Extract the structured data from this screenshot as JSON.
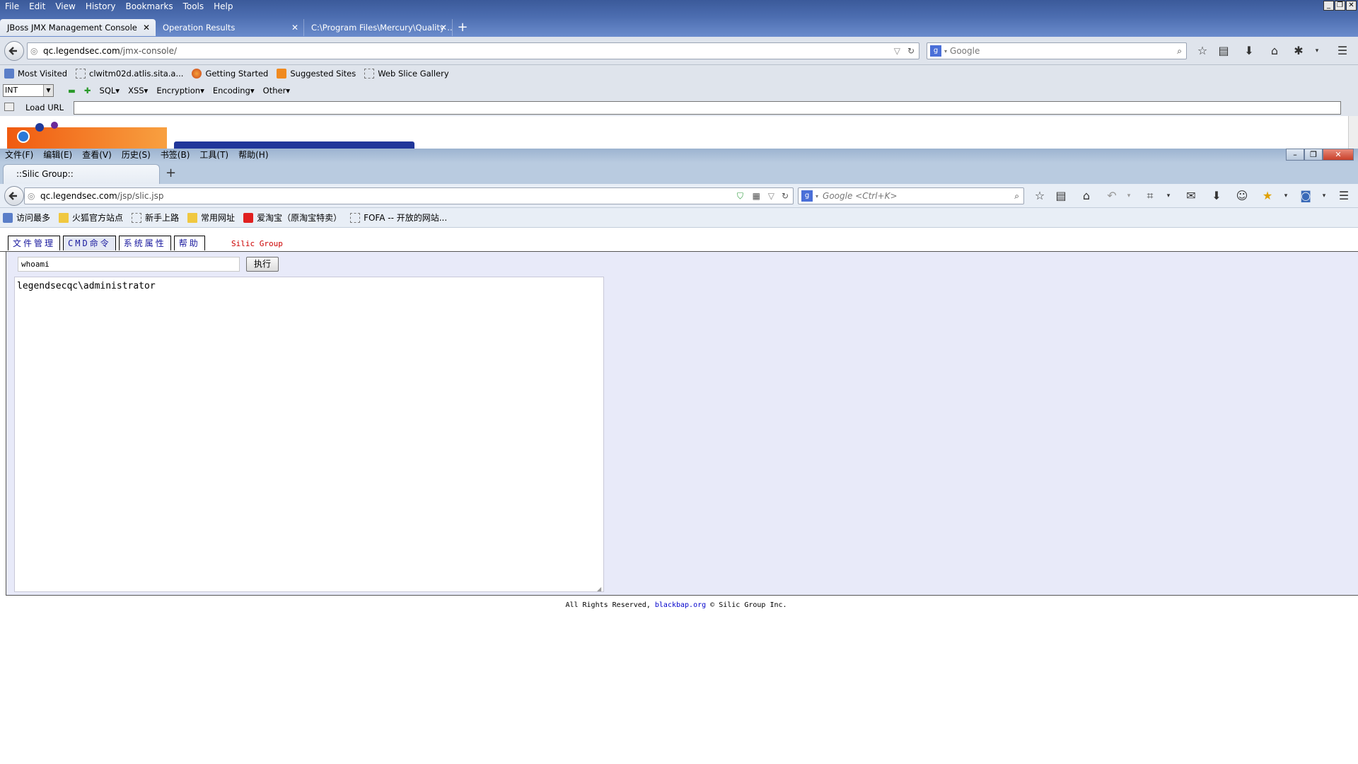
{
  "back_window": {
    "menu": [
      "File",
      "Edit",
      "View",
      "History",
      "Bookmarks",
      "Tools",
      "Help"
    ],
    "tabs": [
      {
        "label": "JBoss JMX Management Console",
        "active": true
      },
      {
        "label": "Operation Results",
        "active": false
      },
      {
        "label": "C:\\Program Files\\Mercury\\Quality ...",
        "active": false
      }
    ],
    "url_host": "qc.legendsec.com",
    "url_path": "/jmx-console/",
    "search_placeholder": "Google",
    "bookmarks": [
      "Most Visited",
      "clwitm02d.atlis.sita.a...",
      "Getting Started",
      "Suggested Sites",
      "Web Slice Gallery"
    ],
    "hackbar": {
      "select_value": "INT",
      "menus": [
        "SQL",
        "XSS",
        "Encryption",
        "Encoding",
        "Other"
      ],
      "load_url_label": "Load URL"
    }
  },
  "front_window": {
    "menu": [
      "文件(F)",
      "编辑(E)",
      "查看(V)",
      "历史(S)",
      "书签(B)",
      "工具(T)",
      "帮助(H)"
    ],
    "tab_label": "::Silic Group::",
    "url_host": "qc.legendsec.com",
    "url_path": "/jsp/slic.jsp",
    "search_placeholder": "Google <Ctrl+K>",
    "bookmarks": [
      "访问最多",
      "火狐官方站点",
      "新手上路",
      "常用网址",
      "爱淘宝（原淘宝特卖）",
      "FOFA -- 开放的网站..."
    ]
  },
  "page": {
    "nav_tabs": [
      {
        "label": "文件管理",
        "active": false
      },
      {
        "label": "CMD命令",
        "active": true
      },
      {
        "label": "系统属性",
        "active": false
      },
      {
        "label": "帮助",
        "active": false
      }
    ],
    "brand": "Silic Group",
    "command_value": "whoami",
    "exec_label": "执行",
    "output": "legendsecqc\\administrator",
    "footer_prefix": "All Rights Reserved,",
    "footer_link": "blackbap.org",
    "footer_suffix": "© Silic Group Inc."
  },
  "colors": {
    "panel_bg": "#e8eaf9",
    "nav_tab_text": "#1a1a9e",
    "brand_red": "#cc0000",
    "link_blue": "#0000cc"
  }
}
